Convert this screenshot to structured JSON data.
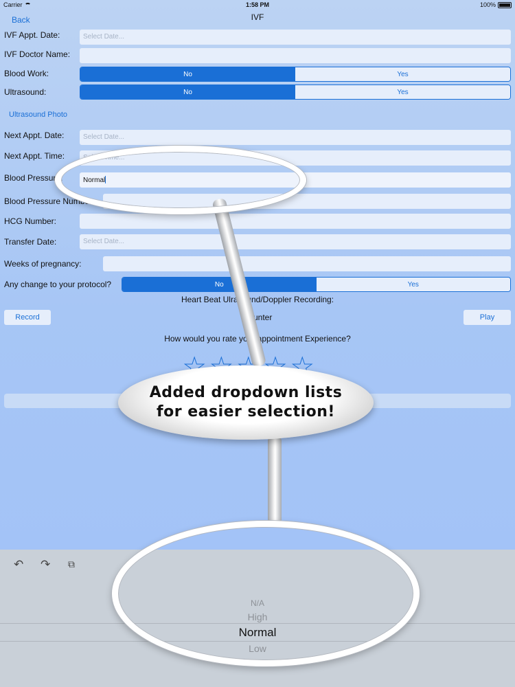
{
  "status_bar": {
    "carrier": "Carrier",
    "time": "1:58 PM",
    "battery": "100%"
  },
  "nav": {
    "back": "Back",
    "title": "IVF"
  },
  "form": {
    "ivf_appt_date": {
      "label": "IVF Appt. Date:",
      "placeholder": "Select Date..."
    },
    "ivf_doctor_name": {
      "label": "IVF Doctor Name:",
      "value": ""
    },
    "blood_work": {
      "label": "Blood Work:",
      "options": [
        "No",
        "Yes"
      ],
      "selected": "No"
    },
    "ultrasound": {
      "label": "Ultrasound:",
      "options": [
        "No",
        "Yes"
      ],
      "selected": "No"
    },
    "ultrasound_photo": "Ultrasound Photo",
    "next_appt_date": {
      "label": "Next Appt. Date:",
      "placeholder": "Select Date..."
    },
    "next_appt_time": {
      "label": "Next Appt. Time:",
      "placeholder": "Select Time..."
    },
    "blood_pressure": {
      "label": "Blood Pressure:",
      "value": "Normal"
    },
    "blood_pressure_number": {
      "label": "Blood Pressure Number:",
      "value": ""
    },
    "hcg_number": {
      "label": "HCG Number:",
      "value": ""
    },
    "transfer_date": {
      "label": "Transfer Date:",
      "placeholder": "Select Date..."
    },
    "weeks_of_pregnancy": {
      "label": "Weeks of pregnancy:",
      "value": ""
    },
    "protocol_change": {
      "label": "Any change to your protocol?",
      "options": [
        "No",
        "Yes"
      ],
      "selected": "No"
    }
  },
  "recording": {
    "heading": "Heart Beat Ulrasound/Doppler Recording:",
    "record": "Record",
    "counter": "Counter",
    "play": "Play"
  },
  "rating": {
    "question": "How would you rate your appointment Experience?",
    "max": 5,
    "value": 0
  },
  "callout": {
    "line1": "Added dropdown lists",
    "line2": "for easier selection!"
  },
  "keyboard": {
    "undo_icon": "undo-icon",
    "redo_icon": "redo-icon",
    "paste_icon": "clipboard-icon",
    "picker_options": [
      "N/A",
      "High",
      "Normal",
      "Low"
    ],
    "picker_selected": "Normal"
  }
}
